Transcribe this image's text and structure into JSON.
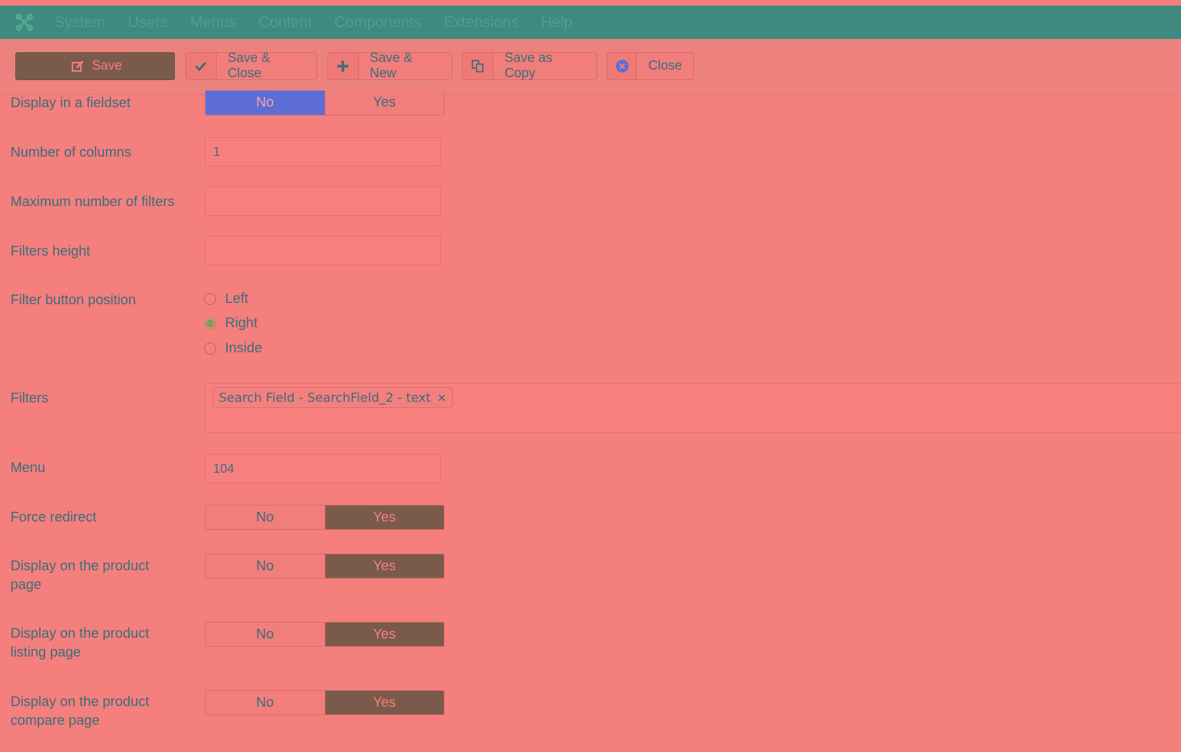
{
  "nav": {
    "items": [
      "System",
      "Users",
      "Menus",
      "Content",
      "Components",
      "Extensions",
      "Help"
    ]
  },
  "toolbar": {
    "save": "Save",
    "save_close": "Save & Close",
    "save_new": "Save & New",
    "save_copy": "Save as Copy",
    "close": "Close"
  },
  "form": {
    "fieldset": {
      "label": "Display in a fieldset",
      "no": "No",
      "yes": "Yes",
      "selected": "No"
    },
    "columns": {
      "label": "Number of columns",
      "value": "1"
    },
    "max_filters": {
      "label": "Maximum number of filters",
      "value": ""
    },
    "filters_height": {
      "label": "Filters height",
      "value": ""
    },
    "button_position": {
      "label": "Filter button position",
      "options": [
        "Left",
        "Right",
        "Inside"
      ],
      "selected": "Right"
    },
    "filters": {
      "label": "Filters",
      "tag": "Search Field - SearchField_2 - text"
    },
    "menu": {
      "label": "Menu",
      "value": "104"
    },
    "force_redirect": {
      "label": "Force redirect",
      "no": "No",
      "yes": "Yes",
      "selected": "Yes"
    },
    "product_page": {
      "label_line1": "Display on the product",
      "label_line2": "page",
      "no": "No",
      "yes": "Yes",
      "selected": "Yes"
    },
    "listing_page": {
      "label_line1": "Display on the product",
      "label_line2": "listing page",
      "no": "No",
      "yes": "Yes",
      "selected": "Yes"
    },
    "compare_page": {
      "label_line1": "Display on the product",
      "label_line2": "compare page",
      "no": "No",
      "yes": "Yes",
      "selected": "Yes"
    }
  },
  "colors": {
    "page_bg": "#f47f7d",
    "navbar_bg": "#3f8a80",
    "save_btn": "#7a5a4b",
    "toggle_no_active": "#5c6ed6",
    "toggle_yes_active": "#7a5a4b",
    "text": "#3b6d7c"
  }
}
